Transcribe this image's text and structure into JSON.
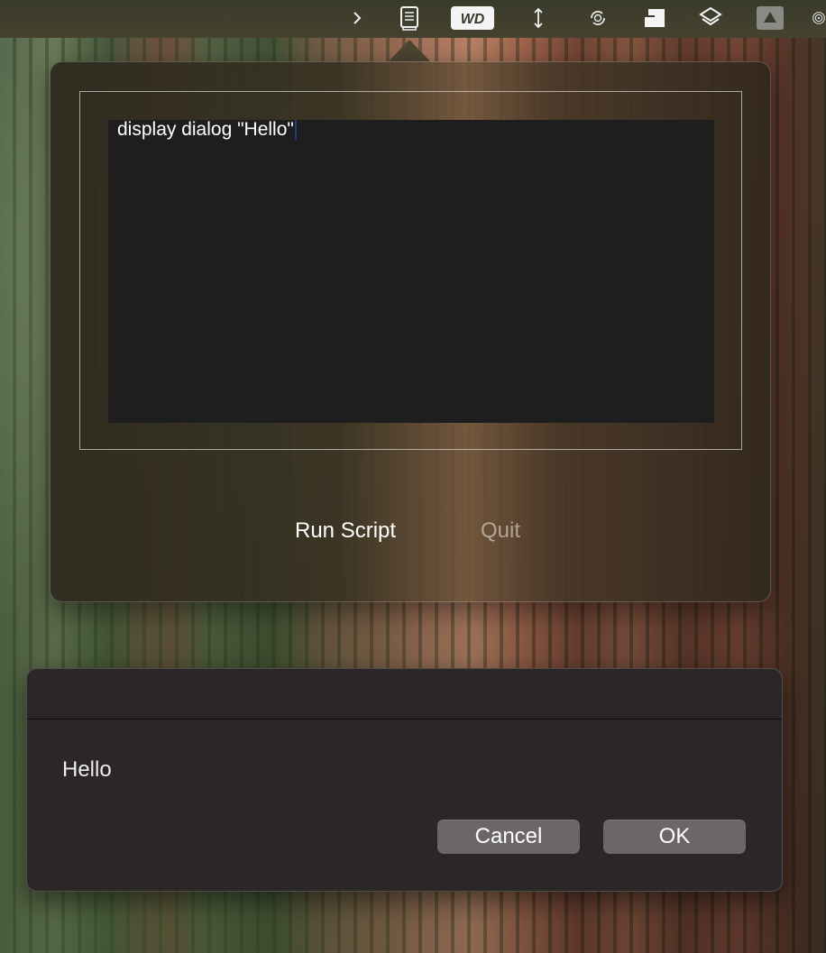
{
  "menubar": {
    "icons": [
      {
        "name": "chevron-right-icon",
        "glyph": "›"
      },
      {
        "name": "book-icon"
      },
      {
        "name": "wd-icon",
        "label": "WD"
      },
      {
        "name": "vertical-arrows-icon",
        "glyph": "↕"
      },
      {
        "name": "sync-icon"
      },
      {
        "name": "squares-icon"
      },
      {
        "name": "layers-icon"
      },
      {
        "name": "drive-icon"
      },
      {
        "name": "airdrop-icon"
      }
    ]
  },
  "popover": {
    "script_text": "display dialog \"Hello\"",
    "run_label": "Run Script",
    "quit_label": "Quit"
  },
  "dialog": {
    "message": "Hello",
    "cancel_label": "Cancel",
    "ok_label": "OK"
  },
  "colors": {
    "editor_bg": "#1f1e1f",
    "dialog_bg": "#2b2726",
    "button_bg": "#6b6767"
  }
}
